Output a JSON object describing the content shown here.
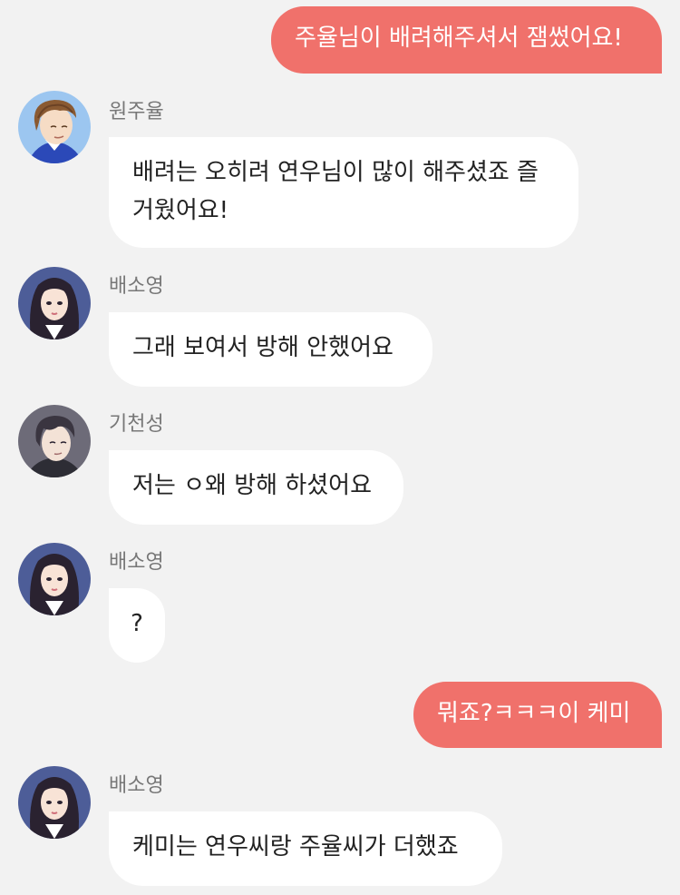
{
  "messages": [
    {
      "id": "m1",
      "direction": "out",
      "text": "주율님이 배려해주셔서 잼썼어요!"
    },
    {
      "id": "m2",
      "direction": "in",
      "sender": "원주율",
      "avatar": "curly-brown-hair-man-avatar",
      "text": "배려는 오히려 연우님이 많이 해주셨죠 즐거웠어요!"
    },
    {
      "id": "m3",
      "direction": "in",
      "sender": "배소영",
      "avatar": "long-dark-hair-woman-avatar",
      "text": "그래 보여서 방해 안했어요"
    },
    {
      "id": "m4",
      "direction": "in",
      "sender": "기천성",
      "avatar": "dark-hair-man-avatar",
      "text": "저는 ㅇ왜 방해 하셨어요"
    },
    {
      "id": "m5",
      "direction": "in",
      "sender": "배소영",
      "avatar": "long-dark-hair-woman-avatar",
      "text": "?"
    },
    {
      "id": "m6",
      "direction": "out",
      "text": "뭐죠?ㅋㅋㅋ이 케미"
    },
    {
      "id": "m7",
      "direction": "in",
      "sender": "배소영",
      "avatar": "long-dark-hair-woman-avatar",
      "text": "케미는 연우씨랑 주율씨가 더했죠"
    }
  ],
  "colors": {
    "background": "#f2f2f2",
    "outgoing_bubble": "#f0716b",
    "incoming_bubble": "#ffffff",
    "sender_name": "#777777"
  }
}
